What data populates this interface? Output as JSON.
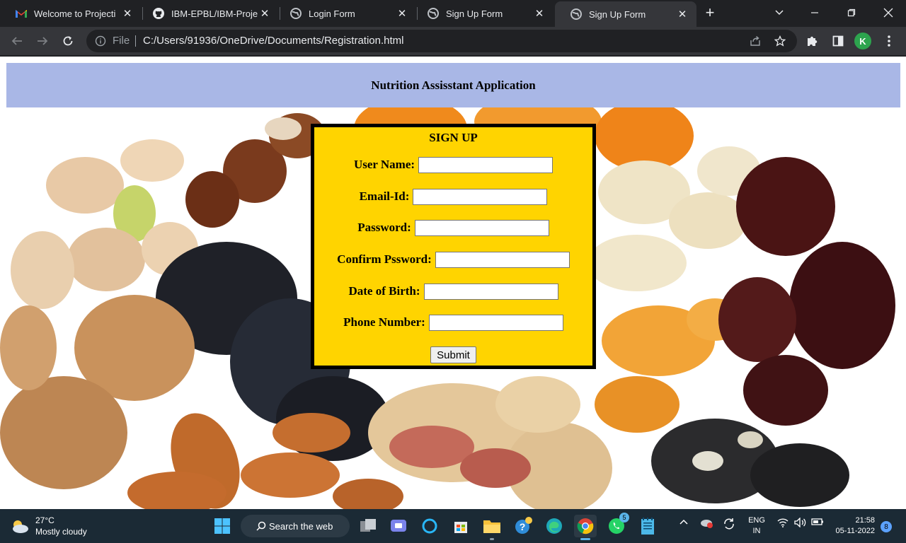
{
  "browser": {
    "tabs": [
      {
        "title": "Welcome to Projecti",
        "icon": "gmail-icon"
      },
      {
        "title": "IBM-EPBL/IBM-Proje",
        "icon": "github-icon"
      },
      {
        "title": "Login Form",
        "icon": "globe-icon"
      },
      {
        "title": "Sign Up Form",
        "icon": "globe-icon"
      },
      {
        "title": "Sign Up Form",
        "icon": "globe-icon",
        "active": true
      }
    ],
    "address": {
      "scheme_label": "File",
      "url": "C:/Users/91936/OneDrive/Documents/Registration.html"
    },
    "profile_initial": "K"
  },
  "page": {
    "header_title": "Nutrition Assisstant Application",
    "form": {
      "title": "SIGN UP",
      "fields": [
        {
          "label": "User Name:",
          "value": ""
        },
        {
          "label": "Email-Id:",
          "value": ""
        },
        {
          "label": "Password:",
          "value": ""
        },
        {
          "label": "Confirm Pssword:",
          "value": ""
        },
        {
          "label": "Date of Birth:",
          "value": ""
        },
        {
          "label": "Phone Number:",
          "value": ""
        }
      ],
      "submit_label": "Submit"
    },
    "colors": {
      "header_bg": "#a9b7e6",
      "form_bg": "#ffd400",
      "form_border": "#000000"
    }
  },
  "taskbar": {
    "weather": {
      "temp": "27°C",
      "condition": "Mostly cloudy"
    },
    "search_placeholder": "Search the web",
    "whatsapp_badge": "5",
    "language": {
      "line1": "ENG",
      "line2": "IN"
    },
    "clock": {
      "time": "21:58",
      "date": "05-11-2022"
    },
    "notifications": "8"
  }
}
